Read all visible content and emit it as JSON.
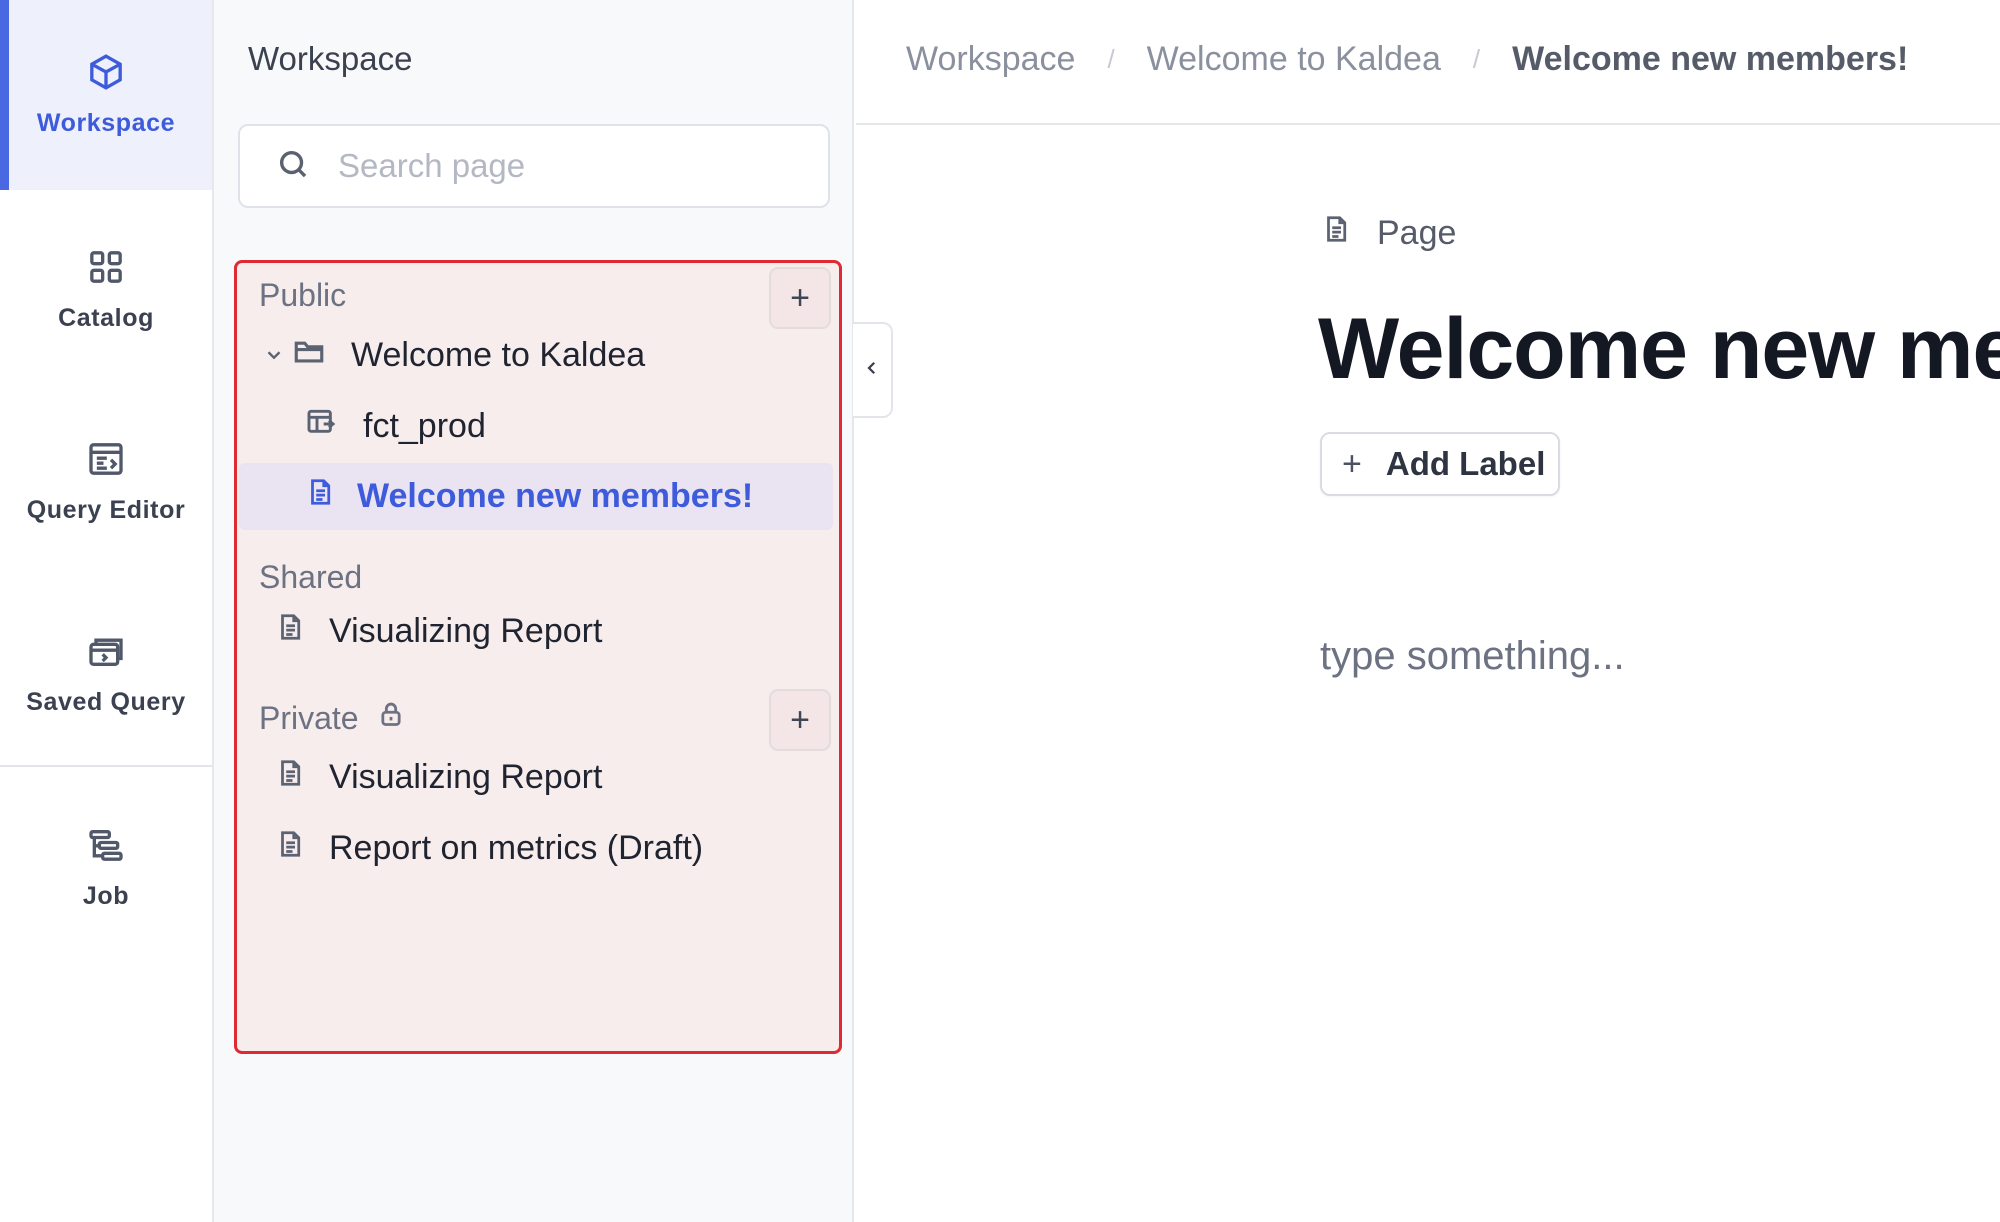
{
  "rail": {
    "items": [
      {
        "label": "Workspace",
        "icon": "cube-icon",
        "active": true
      },
      {
        "label": "Catalog",
        "icon": "grid-icon"
      },
      {
        "label": "Query Editor",
        "icon": "query-editor-icon"
      },
      {
        "label": "Saved Query",
        "icon": "saved-query-icon"
      },
      {
        "label": "Job",
        "icon": "job-icon"
      }
    ]
  },
  "panel": {
    "title": "Workspace",
    "search": {
      "placeholder": "Search page",
      "value": ""
    },
    "sections": {
      "public": {
        "label": "Public",
        "add_label": "+",
        "items": [
          {
            "label": "Welcome to Kaldea",
            "icon": "folder-icon",
            "expanded": true
          },
          {
            "label": "fct_prod",
            "icon": "table-icon"
          },
          {
            "label": "Welcome new members!",
            "icon": "page-icon",
            "selected": true
          }
        ]
      },
      "shared": {
        "label": "Shared",
        "items": [
          {
            "label": "Visualizing Report",
            "icon": "page-icon"
          }
        ]
      },
      "private": {
        "label": "Private",
        "icon": "lock-icon",
        "add_label": "+",
        "items": [
          {
            "label": "Visualizing Report",
            "icon": "page-icon"
          },
          {
            "label": "Report on metrics (Draft)",
            "icon": "page-icon"
          }
        ]
      }
    },
    "highlight_color": "#de2b33"
  },
  "breadcrumb": {
    "items": [
      "Workspace",
      "Welcome to Kaldea",
      "Welcome new members!"
    ],
    "separator": "/"
  },
  "page": {
    "kind_label": "Page",
    "title": "Welcome new members!",
    "add_label_button": "Add Label",
    "add_label_icon": "+",
    "editor_placeholder": "type something..."
  },
  "colors": {
    "accent": "#3d5bdb",
    "selected_bg": "#eae3f1"
  }
}
